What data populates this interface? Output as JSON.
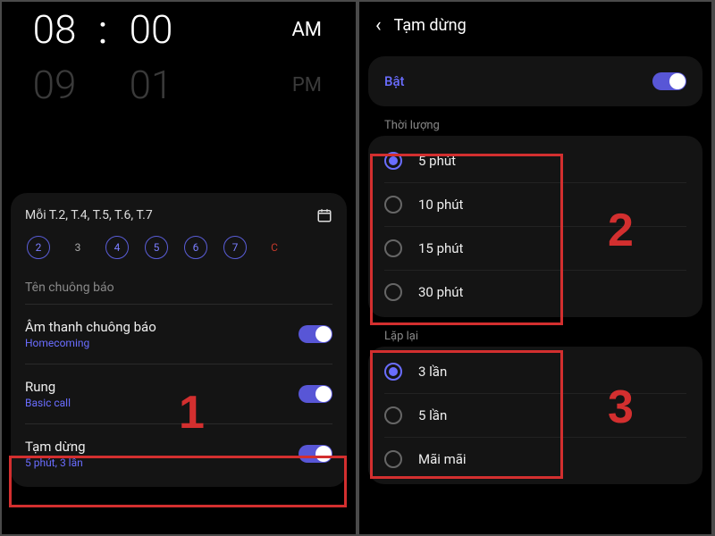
{
  "left": {
    "hour_sel": "08",
    "min_sel": "00",
    "hour_next": "09",
    "min_next": "01",
    "am": "AM",
    "pm": "PM",
    "repeat_label": "Mỗi T.2, T.4, T.5, T.6, T.7",
    "days": [
      "2",
      "3",
      "4",
      "5",
      "6",
      "7",
      "C"
    ],
    "name_label": "Tên chuông báo",
    "sound_title": "Âm thanh chuông báo",
    "sound_sub": "Homecoming",
    "vibe_title": "Rung",
    "vibe_sub": "Basic call",
    "snooze_title": "Tạm dừng",
    "snooze_sub": "5 phút, 3 lần"
  },
  "right": {
    "title": "Tạm dừng",
    "enable_label": "Bật",
    "duration_label": "Thời lượng",
    "durations": {
      "d0": "5 phút",
      "d1": "10 phút",
      "d2": "15 phút",
      "d3": "30 phút"
    },
    "repeat_label": "Lặp lại",
    "repeats": {
      "r0": "3 lần",
      "r1": "5 lần",
      "r2": "Mãi mãi"
    }
  },
  "annotations": {
    "n1": "1",
    "n2": "2",
    "n3": "3"
  }
}
